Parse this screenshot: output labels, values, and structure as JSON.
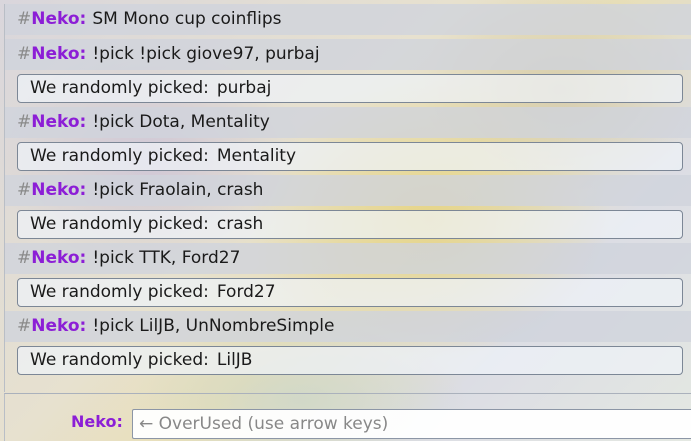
{
  "hash": "#",
  "username": "Neko:",
  "pick_prefix": "We randomly picked:",
  "messages": [
    {
      "text": "SM Mono cup coinflips"
    },
    {
      "text": "!pick !pick giove97, purbaj",
      "result": "purbaj"
    },
    {
      "text": "!pick Dota, Mentality",
      "result": "Mentality"
    },
    {
      "text": "!pick Fraolain, crash",
      "result": "crash"
    },
    {
      "text": "!pick TTK, Ford27",
      "result": "Ford27"
    },
    {
      "text": "!pick LilJB, UnNombreSimple",
      "result": "LilJB"
    }
  ],
  "composer": {
    "name": "Neko:",
    "placeholder": "← OverUsed (use arrow keys)",
    "value": ""
  }
}
